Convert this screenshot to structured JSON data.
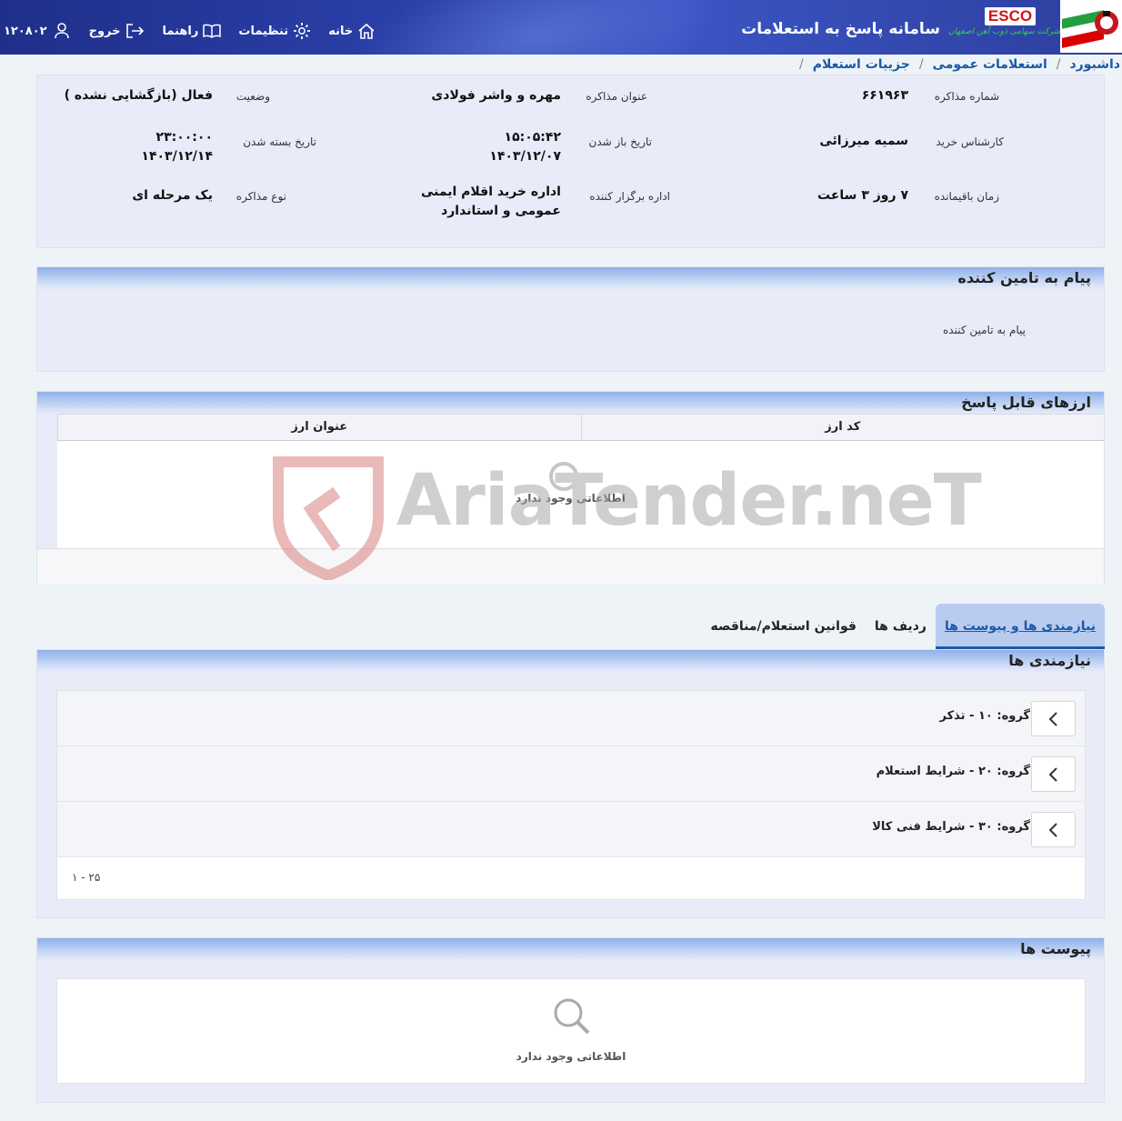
{
  "header": {
    "app_title": "سامانه پاسخ به استعلامات",
    "brand": "ESCO",
    "brand_subtitle": "شرکت سهامی ذوب آهن اصفهان",
    "nav": {
      "home": "خانه",
      "settings": "تنظیمات",
      "guide": "راهنما",
      "logout": "خروج",
      "user_id": "۱۲۰۸۰۲"
    }
  },
  "breadcrumb": {
    "items": [
      "داشبورد",
      "استعلامات عمومی",
      "جزییات استعلام"
    ]
  },
  "details": {
    "negotiation_number_label": "شماره مذاکره",
    "negotiation_number": "۶۶۱۹۶۳",
    "subject_label": "عنوان مذاکره",
    "subject": "مهره و واشر فولادی",
    "status_label": "وضعیت",
    "status": "فعال (بازگشایی نشده )",
    "buyer_label": "کارشناس خرید",
    "buyer": "سمیه میرزائی",
    "open_date_label": "تاریخ باز شدن",
    "open_time": "۱۵:۰۵:۴۲",
    "open_date": "۱۴۰۳/۱۲/۰۷",
    "close_date_label": "تاریخ بسته شدن",
    "close_time": "۲۳:۰۰:۰۰",
    "close_date": "۱۴۰۳/۱۲/۱۴",
    "remaining_label": "زمان باقیمانده",
    "remaining": "۷ روز ۳ ساعت",
    "organizer_label": "اداره برگزار کننده",
    "organizer_line1": "اداره خرید اقلام ایمنی",
    "organizer_line2": "عمومی و استاندارد",
    "type_label": "نوع مذاکره",
    "type": "یک مرحله ای"
  },
  "supplier_message": {
    "title": "پیام به تامین کننده",
    "field_label": "پیام به تامین کننده"
  },
  "currencies": {
    "title": "ارزهای قابل پاسخ",
    "columns": [
      "کد ارز",
      "عنوان ارز"
    ],
    "empty_text": "اطلاعاتی وجود ندارد"
  },
  "watermark": {
    "text": "AriaTender.neT"
  },
  "tabs": [
    {
      "label": "نیازمندی ها و پیوست ها",
      "active": true
    },
    {
      "label": "ردیف ها",
      "active": false
    },
    {
      "label": "قوانین استعلام/مناقصه",
      "active": false
    }
  ],
  "requirements": {
    "title": "نیازمندی ها",
    "groups": [
      {
        "label": "گروه: ۱۰ - تذکر"
      },
      {
        "label": "گروه: ۲۰ - شرایط استعلام"
      },
      {
        "label": "گروه: ۳۰ - شرایط فنی کالا"
      }
    ],
    "pager": "۱ - ۲۵"
  },
  "attachments": {
    "title": "پیوست ها",
    "empty_text": "اطلاعاتی وجود ندارد"
  },
  "colors": {
    "header_bg": "#2a3fa8",
    "link": "#1a5aa8",
    "panel_bg": "#e9ecf8",
    "panel_head": "#8fb0ea"
  }
}
